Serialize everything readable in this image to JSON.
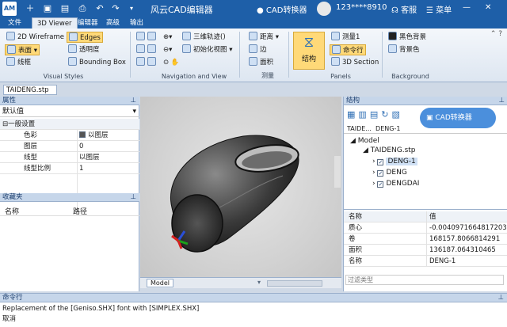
{
  "titlebar": {
    "app_logo": "AM",
    "title": "风云CAD编辑器",
    "converter": "CAD转换器",
    "phone": "123****8910",
    "service": "客服",
    "menu": "菜单",
    "quick_icons": [
      "plus-icon",
      "folder-icon",
      "save-icon",
      "print-icon",
      "undo-icon",
      "redo-icon",
      "dropdown-icon"
    ]
  },
  "tabs": [
    "文件",
    "3D Viewer",
    "编辑器",
    "高级",
    "输出"
  ],
  "active_tab": "3D Viewer",
  "ribbon": {
    "visual_styles": {
      "label": "Visual Styles",
      "buttons": [
        "2D Wireframe",
        "Edges",
        "表面",
        "透明度",
        "线框",
        "Bounding Box"
      ]
    },
    "navigation": {
      "label": "Navigation and View",
      "buttons": [
        "三维轨迹()",
        "初始化视图"
      ]
    },
    "measure": {
      "label": "测量",
      "buttons": [
        "距离",
        "边",
        "面积"
      ]
    },
    "panels": {
      "label": "Panels",
      "big": "结构",
      "buttons": [
        "测量1",
        "命令行",
        "3D Section"
      ]
    },
    "background": {
      "label": "Background",
      "buttons": [
        "黑色背景",
        "背景色"
      ]
    }
  },
  "document_tab": "TAIDENG.stp",
  "properties": {
    "title": "属性",
    "dropdown": "默认值",
    "section": "一般设置",
    "rows": [
      {
        "name": "色彩",
        "value": "以图层"
      },
      {
        "name": "图层",
        "value": "0"
      },
      {
        "name": "线型",
        "value": "以图层"
      },
      {
        "name": "线型比例",
        "value": "1"
      }
    ]
  },
  "favorites": {
    "title": "收藏夹",
    "col_name": "名称",
    "col_path": "路径"
  },
  "viewport": {
    "tab": "Model"
  },
  "structure": {
    "title": "结构",
    "breadcrumb": [
      "TAIDE...",
      "DENG-1"
    ],
    "tree": {
      "root": "Model",
      "file": "TAIDENG.stp",
      "children": [
        "DENG-1",
        "DENG",
        "DENGDAI"
      ]
    },
    "converter_badge": "CAD转换器"
  },
  "props_table": {
    "header": [
      "名称",
      "值"
    ],
    "rows": [
      {
        "name": "质心",
        "value": "-0.0040971664817203;-..."
      },
      {
        "name": "卷",
        "value": "168157.8066814291"
      },
      {
        "name": "面积",
        "value": "136187.064310465"
      },
      {
        "name": "名称",
        "value": "DENG-1"
      }
    ],
    "filter_placeholder": "过滤类型"
  },
  "command": {
    "title": "命令行",
    "lines": [
      "Replacement of the [Geniso.SHX] font with [SIMPLEX.SHX]",
      "取消"
    ]
  }
}
